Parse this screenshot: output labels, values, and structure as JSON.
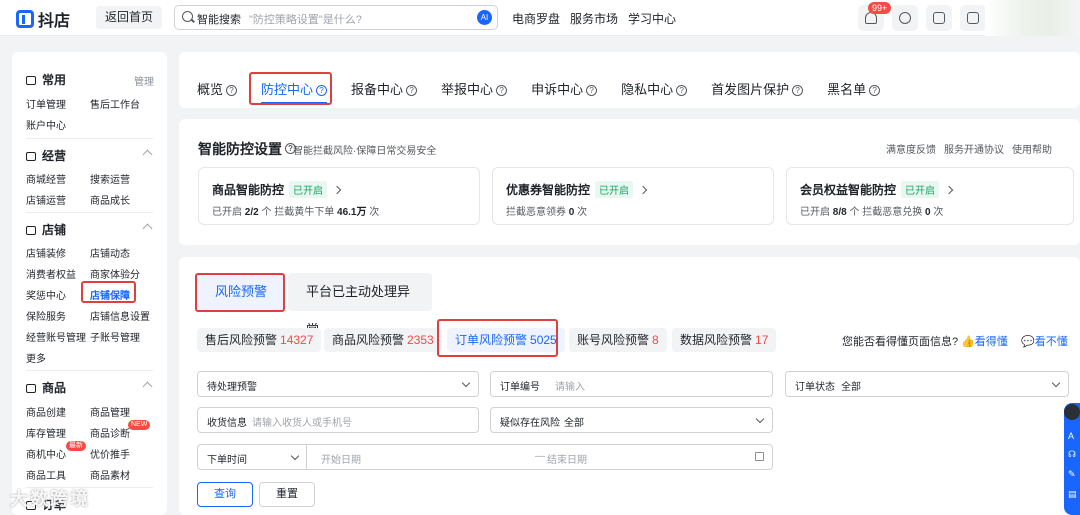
{
  "app": {
    "name": "抖店",
    "back_label": "返回首页"
  },
  "search": {
    "label": "智能搜索",
    "placeholder": "\"防控策略设置\"是什么?",
    "ai_label": "AI"
  },
  "topnav": [
    "电商罗盘",
    "服务市场",
    "学习中心"
  ],
  "notifications": {
    "count": "99+"
  },
  "sidebar": {
    "sections": [
      {
        "title": "常用",
        "side": "管理",
        "items": [
          "订单管理",
          "售后工作台",
          "账户中心"
        ]
      },
      {
        "title": "经营",
        "items": [
          "商城经营",
          "搜索运营",
          "店铺运营",
          "商品成长"
        ]
      },
      {
        "title": "店铺",
        "items": [
          "店铺装修",
          "店铺动态",
          "消费者权益",
          "商家体验分",
          "奖惩中心",
          "店铺保障",
          "保险服务",
          "店铺信息设置",
          "经营账号管理",
          "子账号管理",
          "更多"
        ]
      },
      {
        "title": "商品",
        "items": [
          "商品创建",
          "商品管理",
          "库存管理",
          "商品诊断",
          "商机中心",
          "优价推手",
          "商品工具",
          "商品素材"
        ]
      },
      {
        "title": "订单"
      }
    ],
    "badges": {
      "new": "NEW",
      "latest": "最新"
    }
  },
  "tabs": [
    {
      "label": "概览"
    },
    {
      "label": "防控中心"
    },
    {
      "label": "报备中心"
    },
    {
      "label": "举报中心"
    },
    {
      "label": "申诉中心"
    },
    {
      "label": "隐私中心"
    },
    {
      "label": "首发图片保护"
    },
    {
      "label": "黑名单"
    }
  ],
  "settings": {
    "title": "智能防控设置",
    "subtitle": "智能拦截风险·保障日常交易安全",
    "links": [
      "满意度反馈",
      "服务开通协议",
      "使用帮助"
    ],
    "cards": [
      {
        "title": "商品智能防控",
        "status": "已开启",
        "p1": "已开启",
        "v1": "2/2",
        "p2": "个  拦截黄牛下单",
        "v2": "46.1万",
        "p3": "次"
      },
      {
        "title": "优惠券智能防控",
        "status": "已开启",
        "p1": "拦截恶意领券",
        "v1": "0",
        "p2": "次",
        "v2": "",
        "p3": ""
      },
      {
        "title": "会员权益智能防控",
        "status": "已开启",
        "p1": "已开启",
        "v1": "8/8",
        "p2": "个  拦截恶意兑换",
        "v2": "0",
        "p3": "次"
      }
    ]
  },
  "risk": {
    "tab_active": "风险预警",
    "tab_other": "平台已主动处理异常",
    "chips": [
      {
        "label": "售后风险预警",
        "count": "14327"
      },
      {
        "label": "商品风险预警",
        "count": "2353"
      },
      {
        "label": "订单风险预警",
        "count": "5025"
      },
      {
        "label": "账号风险预警",
        "count": "8"
      },
      {
        "label": "数据风险预警",
        "count": "17"
      }
    ],
    "ask": "您能否看得懂页面信息?",
    "yes": "看得懂",
    "no": "看不懂",
    "filters": {
      "status_select": "待处理预警",
      "order_no_label": "订单编号",
      "order_no_placeholder": "请输入",
      "order_state_label": "订单状态",
      "order_state_value": "全部",
      "receiver_label": "收货信息",
      "receiver_placeholder": "请输入收货人或手机号",
      "suspect_label": "疑似存在风险",
      "suspect_value": "全部",
      "time_select": "下单时间",
      "start_placeholder": "开始日期",
      "end_placeholder": "结束日期"
    },
    "query": "查询",
    "reset": "重置"
  },
  "watermark": "大数跨境",
  "colors": {
    "accent": "#1966ff",
    "danger": "#f54a45",
    "success": "#1ba365",
    "highlight_box": "#e0403d"
  }
}
